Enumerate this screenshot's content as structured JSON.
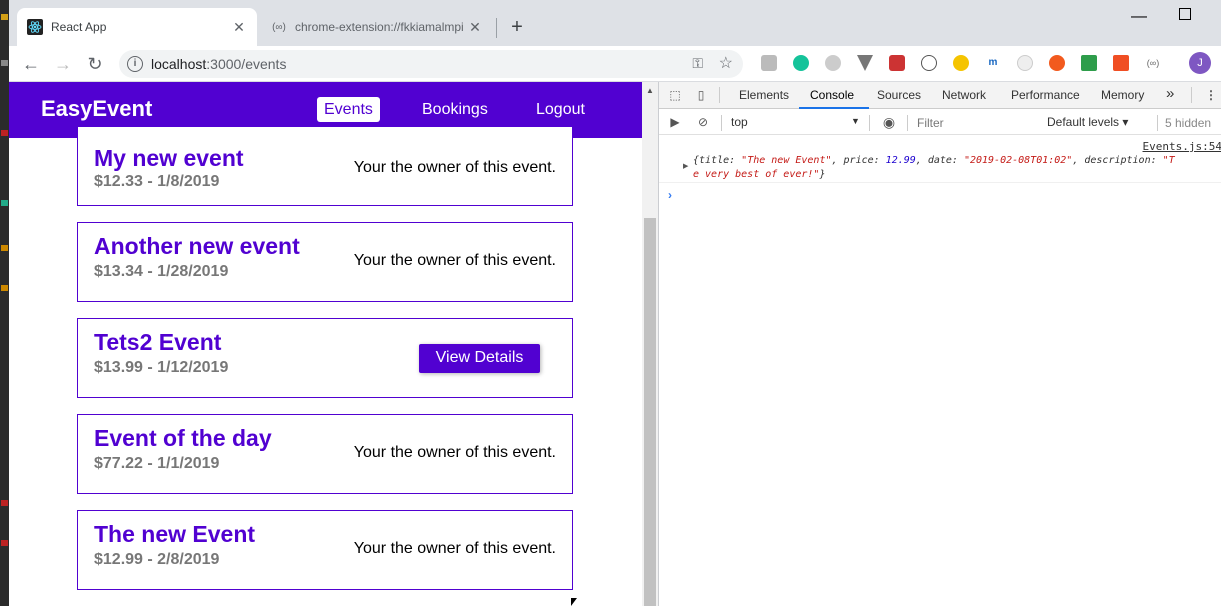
{
  "browser": {
    "tabs": [
      {
        "title": "React App",
        "active": true
      },
      {
        "title": "chrome-extension://fkkiamalmpi",
        "active": false
      }
    ],
    "url_host": "localhost",
    "url_path": ":3000/events",
    "avatar_initial": "J"
  },
  "app": {
    "brand": "EasyEvent",
    "nav": [
      {
        "label": "Events",
        "active": true
      },
      {
        "label": "Bookings",
        "active": false
      },
      {
        "label": "Logout",
        "active": false
      }
    ],
    "accent": "#5101d1",
    "events": [
      {
        "title": "My new event",
        "meta": "$12.33 - 1/8/2019",
        "owner_text": "Your the owner of this event."
      },
      {
        "title": "Another new event",
        "meta": "$13.34 - 1/28/2019",
        "owner_text": "Your the owner of this event."
      },
      {
        "title": "Tets2 Event",
        "meta": "$13.99 - 1/12/2019",
        "button_label": "View Details"
      },
      {
        "title": "Event of the day",
        "meta": "$77.22 - 1/1/2019",
        "owner_text": "Your the owner of this event."
      },
      {
        "title": "The new Event",
        "meta": "$12.99 - 2/8/2019",
        "owner_text": "Your the owner of this event."
      }
    ]
  },
  "devtools": {
    "tabs": [
      "Elements",
      "Console",
      "Sources",
      "Network",
      "Performance",
      "Memory"
    ],
    "active_tab": "Console",
    "more": "»",
    "context": "top",
    "filter_placeholder": "Filter",
    "levels": "Default levels",
    "hidden_count": "5 hidden",
    "log_source": "Events.js:54",
    "log": {
      "open": "{title: ",
      "title": "\"The new Event\"",
      "price_key": ", price: ",
      "price": "12.99",
      "date_key": ", date: ",
      "date": "\"2019-02-08T01:02\"",
      "desc_key": ", description: ",
      "desc_start": "\"T",
      "desc_rest": "e very best of ever!\"",
      "close": "}"
    },
    "prompt": "›"
  }
}
